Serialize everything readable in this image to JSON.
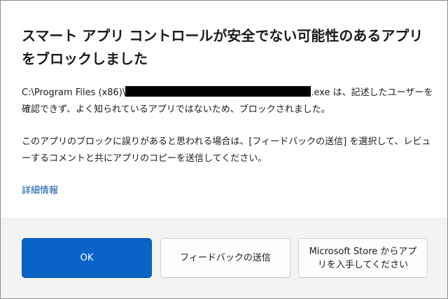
{
  "dialog": {
    "title": "スマート アプリ コントロールが安全でない可能性のあるアプリをブロックしました",
    "path_prefix": "C:\\Program Files (x86)\\",
    "path_suffix": ".exe は、記述したユーザーを確認できず、よく知られているアプリではないため、ブロックされました。",
    "paragraph2": "このアプリのブロックに誤りがあると思われる場合は、[フィードバックの送信] を選択して、レビューするコメントと共にアプリのコピーを送信してください。",
    "more_info_link": "詳細情報"
  },
  "buttons": {
    "ok": "OK",
    "send_feedback": "フィードバックの送信",
    "get_from_store": "Microsoft Store からアプリを入手してください"
  },
  "colors": {
    "primary_button": "#0a64c8",
    "link": "#0a54a6",
    "footer_background": "#f3f3f3"
  }
}
